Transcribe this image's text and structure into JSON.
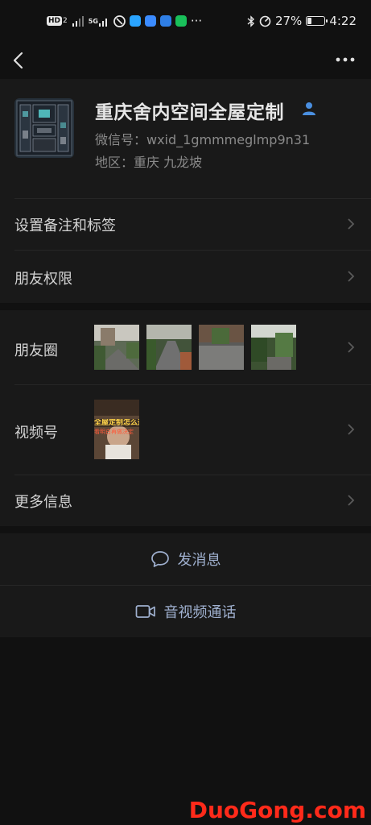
{
  "status_bar": {
    "hd": "HD",
    "sim": "2",
    "signal_label": "5G",
    "battery": "27%",
    "battery_level": 0.27,
    "time": "4:22",
    "more": "···"
  },
  "nav": {
    "back_icon": "chevron-left-icon",
    "more_icon": "more-horizontal-icon"
  },
  "profile": {
    "name": "重庆舍内空间全屋定制",
    "wechat_id": "微信号：wxid_1gmmmeglmp9n31",
    "region": "地区：重庆  九龙坡",
    "verified_icon": "person-icon"
  },
  "rows": {
    "remark_tags": "设置备注和标签",
    "friend_permissions": "朋友权限",
    "moments": "朋友圈",
    "channels": "视频号",
    "more_info": "更多信息"
  },
  "channels_thumb_text": {
    "line1": "全屋定制怎么选",
    "line2": "看明白再做决定"
  },
  "actions": {
    "send_message": "发消息",
    "video_call": "音视频通话"
  },
  "watermark": "DuoGong.com",
  "colors": {
    "background": "#111111",
    "card": "#191919",
    "accent": "#9fb0cf",
    "verified": "#4a8fe0",
    "watermark": "#ff2a1a"
  }
}
